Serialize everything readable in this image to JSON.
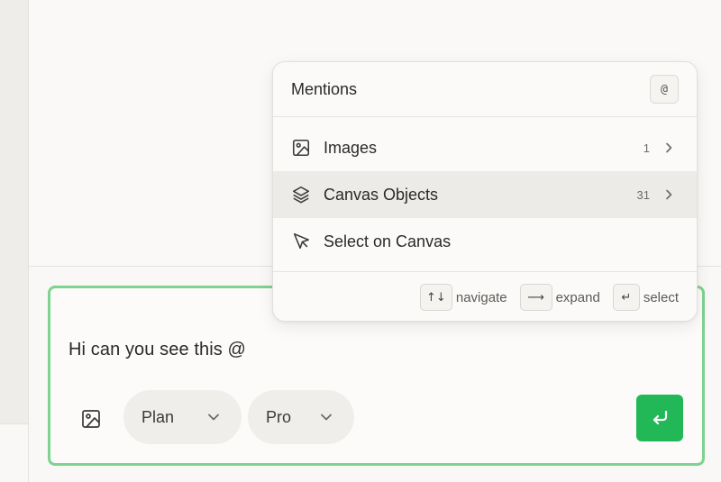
{
  "composer": {
    "text": "Hi can you see this @",
    "plan_label": "Plan",
    "model_label": "Pro"
  },
  "mentions": {
    "title": "Mentions",
    "shortcut": "@",
    "items": [
      {
        "label": "Images",
        "count": "1",
        "icon": "image-icon",
        "has_submenu": true
      },
      {
        "label": "Canvas Objects",
        "count": "31",
        "icon": "layers-icon",
        "has_submenu": true,
        "active": true
      },
      {
        "label": "Select on Canvas",
        "count": "",
        "icon": "cursor-icon",
        "has_submenu": false
      }
    ],
    "hints": [
      {
        "key": "↑↓",
        "label": "navigate"
      },
      {
        "key": "⟶",
        "label": "expand"
      },
      {
        "key": "↵",
        "label": "select"
      }
    ]
  },
  "colors": {
    "accent": "#22b858",
    "focus_border": "#7dd38f",
    "active_row": "#ecebe8"
  }
}
